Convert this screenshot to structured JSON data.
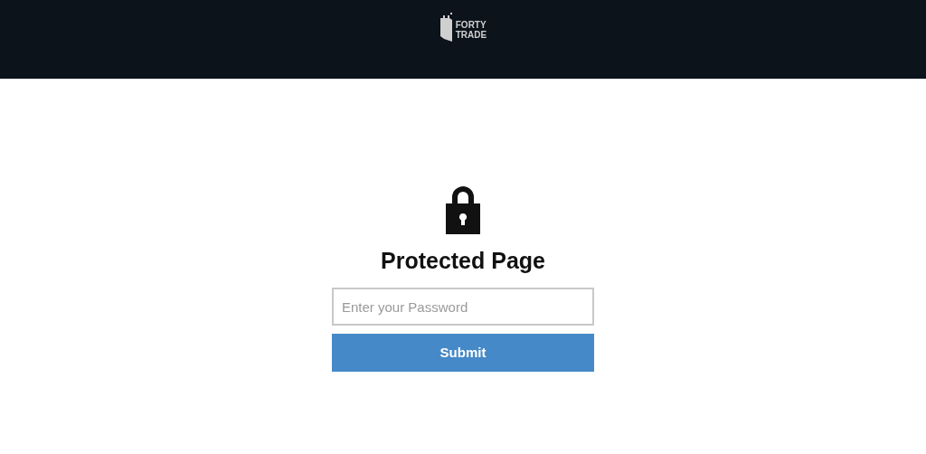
{
  "header": {
    "logo": {
      "line_1": "FORTY",
      "line_2": "TRADE"
    }
  },
  "form": {
    "title": "Protected Page",
    "password": {
      "placeholder": "Enter your Password"
    },
    "submit": "Submit"
  }
}
